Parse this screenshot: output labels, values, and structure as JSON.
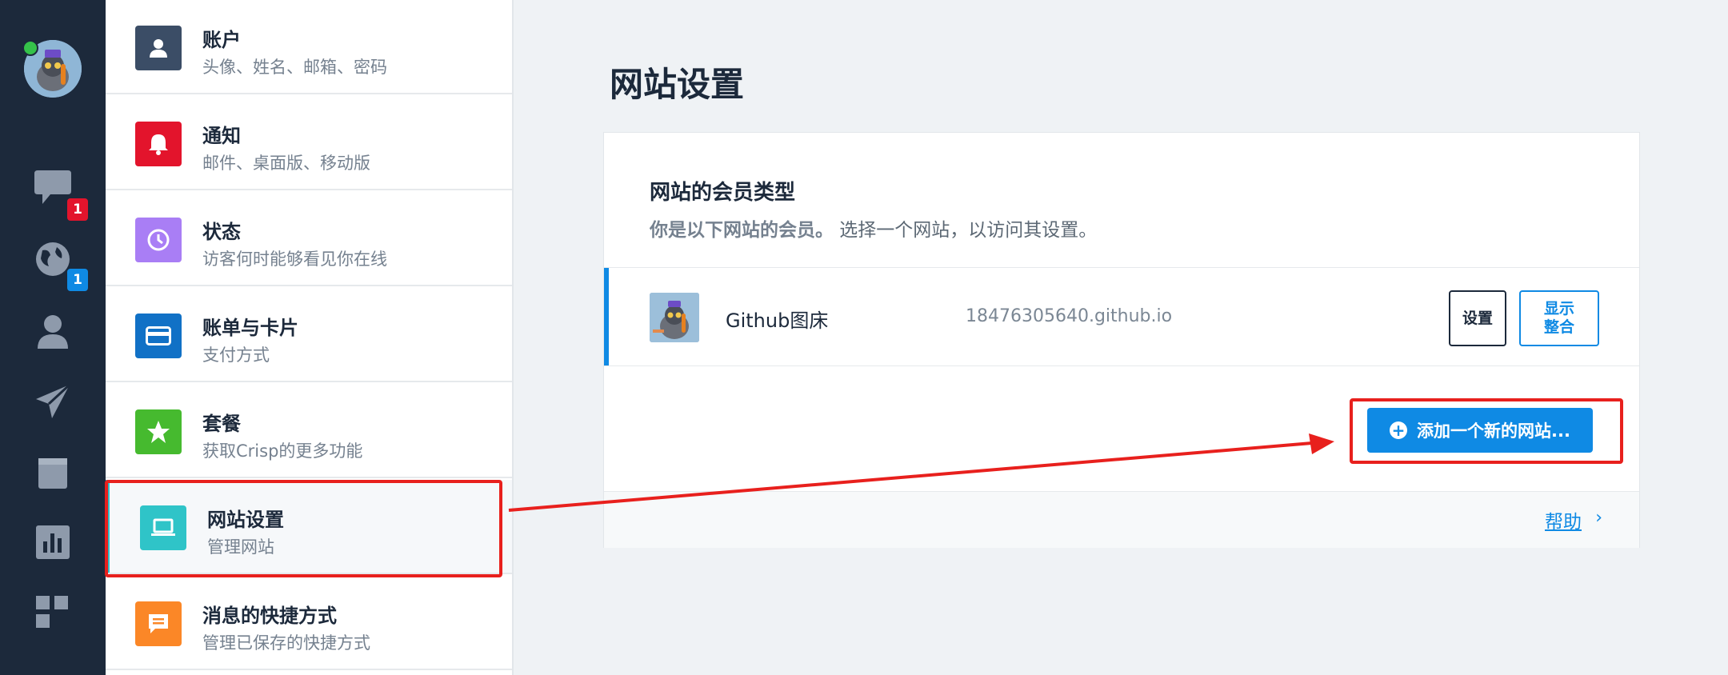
{
  "rail": {
    "badges": {
      "chat": "1",
      "globe": "1"
    }
  },
  "menu": {
    "items": [
      {
        "title": "账户",
        "subtitle": "头像、姓名、邮箱、密码",
        "color": "#3b4d66",
        "icon": "user-icon"
      },
      {
        "title": "通知",
        "subtitle": "邮件、桌面版、移动版",
        "color": "#e3142c",
        "icon": "bell-icon"
      },
      {
        "title": "状态",
        "subtitle": "访客何时能够看见你在线",
        "color": "#a97ef5",
        "icon": "clock-icon"
      },
      {
        "title": "账单与卡片",
        "subtitle": "支付方式",
        "color": "#1171c6",
        "icon": "credit-card-icon"
      },
      {
        "title": "套餐",
        "subtitle": "获取Crisp的更多功能",
        "color": "#46ba2f",
        "icon": "star-icon"
      },
      {
        "title": "网站设置",
        "subtitle": "管理网站",
        "color": "#2fc4c8",
        "icon": "laptop-icon"
      },
      {
        "title": "消息的快捷方式",
        "subtitle": "管理已保存的快捷方式",
        "color": "#fb8727",
        "icon": "message-icon"
      }
    ]
  },
  "main": {
    "page_title": "网站设置",
    "panel": {
      "title": "网站的会员类型",
      "desc_bold": "你是以下网站的会员。",
      "desc_rest": " 选择一个网站，以访问其设置。",
      "site": {
        "name": "Github图床",
        "domain": "18476305640.github.io",
        "settings_label": "设置",
        "integrate_label": "显示整合"
      },
      "add_button_label": "添加一个新的网站...",
      "help_label": "帮助",
      "help_chevron": "›"
    }
  },
  "colors": {
    "rail_bg": "#1c293b",
    "accent": "#0f8ae4",
    "annotation": "#e8201d"
  }
}
